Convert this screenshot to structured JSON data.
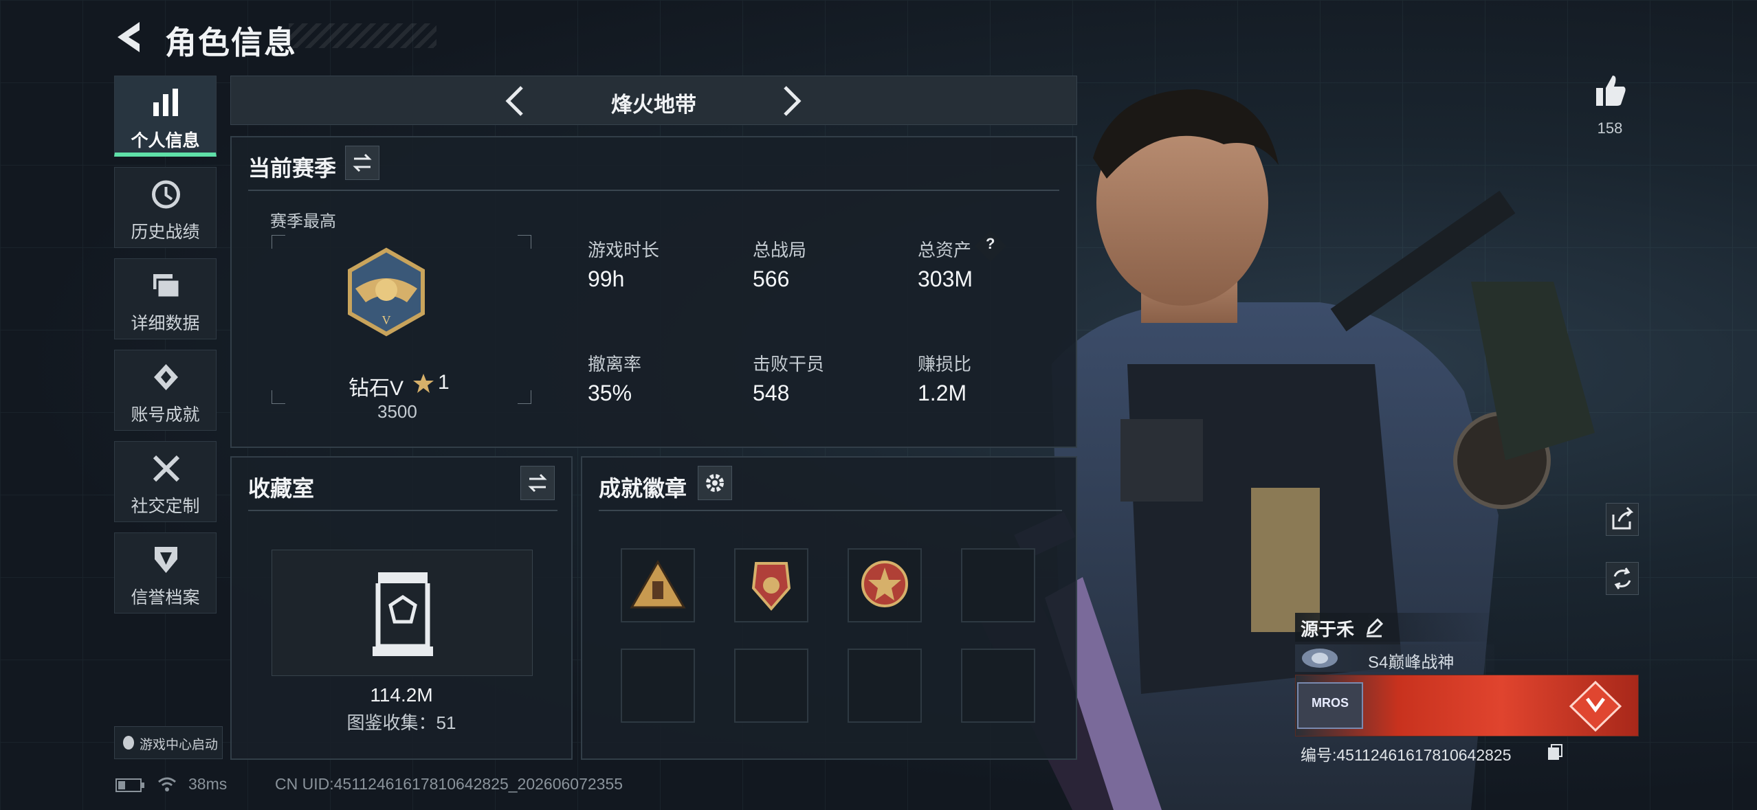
{
  "header": {
    "title": "角色信息"
  },
  "sidebar": {
    "items": [
      {
        "label": "个人信息",
        "active": true,
        "icon": "bar-chart-icon"
      },
      {
        "label": "历史战绩",
        "icon": "clock-icon"
      },
      {
        "label": "详细数据",
        "icon": "folders-icon"
      },
      {
        "label": "账号成就",
        "icon": "achievement-icon"
      },
      {
        "label": "社交定制",
        "icon": "tools-icon"
      },
      {
        "label": "信誉档案",
        "icon": "shield-icon"
      }
    ],
    "launch": "游戏中心启动"
  },
  "mode": {
    "name": "烽火地带"
  },
  "season": {
    "title": "当前赛季",
    "best_label": "赛季最高",
    "rank": "钻石V",
    "stars": "1",
    "score": "3500",
    "stats": [
      {
        "label": "游戏时长",
        "value": "99h"
      },
      {
        "label": "总战局",
        "value": "566"
      },
      {
        "label": "总资产",
        "value": "303M"
      },
      {
        "label": "撤离率",
        "value": "35%"
      },
      {
        "label": "击败干员",
        "value": "548"
      },
      {
        "label": "赚损比",
        "value": "1.2M"
      }
    ],
    "help": "?"
  },
  "collection": {
    "title": "收藏室",
    "value": "114.2M",
    "count_label": "图鉴收集：51"
  },
  "badges": {
    "title": "成就徽章"
  },
  "profile": {
    "likes": "158",
    "name": "源于禾",
    "title": "S4巅峰战神",
    "id": "编号:451124616178106428​25",
    "card_text": "MROS"
  },
  "status": {
    "ping": "38ms",
    "uid": "CN UID:451124616178106428​25_202606072355"
  },
  "colors": {
    "accent": "#5fe0a8",
    "panel": "#18202a",
    "card_red": "#e0422c"
  }
}
